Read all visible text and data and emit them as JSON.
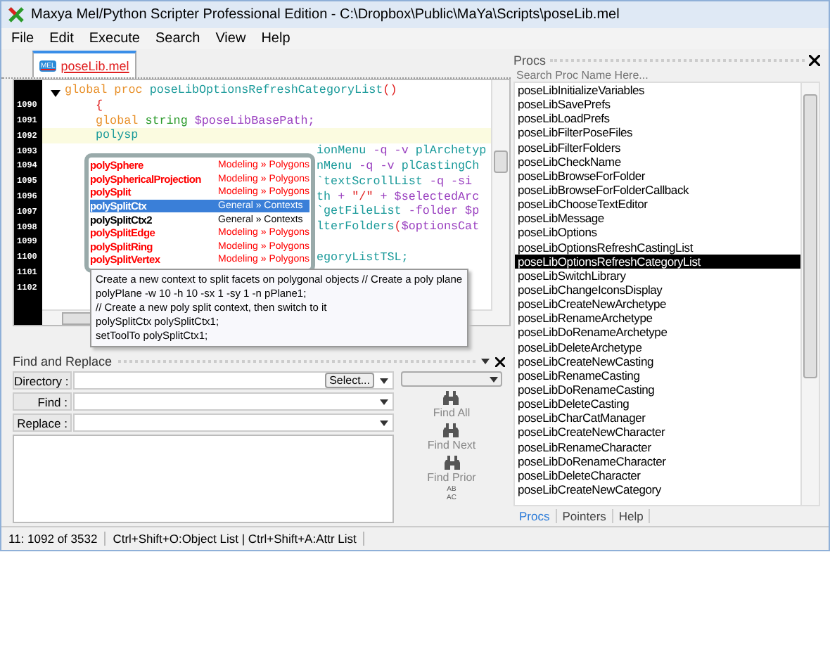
{
  "window": {
    "title": "Maxya Mel/Python Scripter Professional Edition - C:\\Dropbox\\Public\\MaYa\\Scripts\\poseLib.mel"
  },
  "menu": [
    "File",
    "Edit",
    "Execute",
    "Search",
    "View",
    "Help"
  ],
  "tabs": [
    {
      "label": "poseLib.mel",
      "icon_text": "MEL",
      "selected": true
    }
  ],
  "editor": {
    "lines": [
      {
        "kind": "code",
        "current": false,
        "tokens": [
          {
            "kind": "keyword",
            "text": "global proc "
          },
          {
            "kind": "name",
            "text": "poseLibOptionsRefreshCategoryList"
          },
          {
            "kind": "punct",
            "text": "()"
          }
        ]
      },
      {
        "kind": "indented",
        "number": "1090",
        "current": false,
        "tokens": [
          {
            "kind": "punct",
            "text": "{"
          }
        ]
      },
      {
        "kind": "indented",
        "number": "1091",
        "current": false,
        "tokens": [
          {
            "kind": "keyword",
            "text": "global "
          },
          {
            "kind": "type",
            "text": "string"
          },
          {
            "kind": "variable",
            "text": " $poseLibBasePath;"
          }
        ]
      },
      {
        "kind": "indented",
        "number": "1092",
        "current": true,
        "tokens": [
          {
            "kind": "name",
            "text": "polysp"
          }
        ]
      },
      {
        "kind": "tail",
        "number": "1093",
        "current": false,
        "tokens": [
          {
            "kind": "name",
            "text": "ionMenu "
          },
          {
            "kind": "variable",
            "text": "-q -v "
          },
          {
            "kind": "name",
            "text": "plArchetyp"
          }
        ]
      },
      {
        "kind": "tail",
        "number": "1094",
        "current": false,
        "tokens": [
          {
            "kind": "name",
            "text": "nMenu "
          },
          {
            "kind": "variable",
            "text": "-q -v "
          },
          {
            "kind": "name",
            "text": "plCastingCh"
          }
        ]
      },
      {
        "kind": "tail",
        "number": "1095",
        "current": false,
        "tokens": [
          {
            "kind": "name",
            "text": "`textScrollList "
          },
          {
            "kind": "variable",
            "text": "-q -si"
          }
        ]
      },
      {
        "kind": "tail",
        "number": "1096",
        "current": false,
        "tokens": [
          {
            "kind": "name",
            "text": "th "
          },
          {
            "kind": "variable",
            "text": "+ "
          },
          {
            "kind": "punct",
            "text": "\"/\""
          },
          {
            "kind": "variable",
            "text": " + $selectedArc"
          }
        ]
      },
      {
        "kind": "tail",
        "number": "1097",
        "current": false,
        "tokens": [
          {
            "kind": "name",
            "text": "`getFileList "
          },
          {
            "kind": "variable",
            "text": "-folder $p"
          }
        ]
      },
      {
        "kind": "tail",
        "number": "1098",
        "current": false,
        "tokens": [
          {
            "kind": "name",
            "text": "lterFolders"
          },
          {
            "kind": "punct",
            "text": "("
          },
          {
            "kind": "variable",
            "text": "$optionsCat"
          }
        ]
      },
      {
        "kind": "tail",
        "number": "1099",
        "current": false
      },
      {
        "kind": "tail",
        "number": "1100",
        "current": false,
        "tokens": [
          {
            "kind": "name",
            "text": "egoryListTSL;"
          }
        ]
      },
      {
        "kind": "tail",
        "number": "1101",
        "current": false
      },
      {
        "kind": "tail",
        "number": "1102",
        "current": false
      }
    ]
  },
  "completion": [
    {
      "name": "polySphere",
      "category": "Modeling » Polygons",
      "kind": "modeling",
      "selected": false
    },
    {
      "name": "polySphericalProjection",
      "category": "Modeling » Polygons",
      "kind": "modeling",
      "selected": false
    },
    {
      "name": "polySplit",
      "category": "Modeling » Polygons",
      "kind": "modeling",
      "selected": false
    },
    {
      "name": "polySplitCtx",
      "category": "General » Contexts",
      "selected": true
    },
    {
      "name": "polySplitCtx2",
      "category": "General » Contexts",
      "kind": "general",
      "selected": false
    },
    {
      "name": "polySplitEdge",
      "category": "Modeling » Polygons",
      "kind": "modeling",
      "selected": false
    },
    {
      "name": "polySplitRing",
      "category": "Modeling » Polygons",
      "kind": "modeling",
      "selected": false
    },
    {
      "name": "polySplitVertex",
      "category": "Modeling » Polygons",
      "kind": "modeling",
      "selected": false
    }
  ],
  "tooltip": [
    "Create a new context to split facets on polygonal objects // Create a poly plane",
    "polyPlane -w 10 -h 10 -sx 1 -sy 1 -n pPlane1;",
    "// Create a new poly split context, then switch to it",
    "polySplitCtx polySplitCtx1;",
    "setToolTo polySplitCtx1;"
  ],
  "find_panel": {
    "title": "Find and Replace",
    "fields": [
      {
        "label": "Directory :",
        "button": "Select..."
      },
      {
        "label": "Find :"
      },
      {
        "label": "Replace :"
      }
    ],
    "actions": [
      {
        "kind": "find",
        "label": "Find All"
      },
      {
        "kind": "find",
        "label": "Find Next"
      },
      {
        "kind": "find",
        "label": "Find Prior"
      },
      {
        "kind": "replace",
        "label": "AB",
        "sublabel": "AC"
      }
    ]
  },
  "procs": {
    "title": "Procs",
    "placeholder": "Search Proc Name Here...",
    "items": [
      {
        "label": "poseLibInitializeVariables",
        "selected": false
      },
      {
        "label": "poseLibSavePrefs",
        "selected": false
      },
      {
        "label": "poseLibLoadPrefs",
        "selected": false
      },
      {
        "label": "poseLibFilterPoseFiles",
        "selected": false
      },
      {
        "label": "poseLibFilterFolders",
        "selected": false
      },
      {
        "label": "poseLibCheckName",
        "selected": false
      },
      {
        "label": "poseLibBrowseForFolder",
        "selected": false
      },
      {
        "label": "poseLibBrowseForFolderCallback",
        "selected": false
      },
      {
        "label": "poseLibChooseTextEditor",
        "selected": false
      },
      {
        "label": "poseLibMessage",
        "selected": false
      },
      {
        "label": "poseLibOptions",
        "selected": false
      },
      {
        "label": "poseLibOptionsRefreshCastingList",
        "selected": false
      },
      {
        "label": "poseLibOptionsRefreshCategoryList",
        "selected": true
      },
      {
        "label": "poseLibSwitchLibrary",
        "selected": false
      },
      {
        "label": "poseLibChangeIconsDisplay",
        "selected": false
      },
      {
        "label": "poseLibCreateNewArchetype",
        "selected": false
      },
      {
        "label": "poseLibRenameArchetype",
        "selected": false
      },
      {
        "label": "poseLibDoRenameArchetype",
        "selected": false
      },
      {
        "label": "poseLibDeleteArchetype",
        "selected": false
      },
      {
        "label": "poseLibCreateNewCasting",
        "selected": false
      },
      {
        "label": "poseLibRenameCasting",
        "selected": false
      },
      {
        "label": "poseLibDoRenameCasting",
        "selected": false
      },
      {
        "label": "poseLibDeleteCasting",
        "selected": false
      },
      {
        "label": "poseLibCharCatManager",
        "selected": false
      },
      {
        "label": "poseLibCreateNewCharacter",
        "selected": false
      },
      {
        "label": "poseLibRenameCharacter",
        "selected": false
      },
      {
        "label": "poseLibDoRenameCharacter",
        "selected": false
      },
      {
        "label": "poseLibDeleteCharacter",
        "selected": false
      },
      {
        "label": "poseLibCreateNewCategory",
        "selected": false
      }
    ],
    "tabs": [
      {
        "label": "Procs",
        "selected": true
      },
      {
        "label": "Pointers",
        "selected": false
      },
      {
        "label": "Help",
        "selected": false
      }
    ]
  },
  "status_bar": [
    "11: 1092 of 3532",
    "Ctrl+Shift+O:Object List | Ctrl+Shift+A:Attr List"
  ]
}
